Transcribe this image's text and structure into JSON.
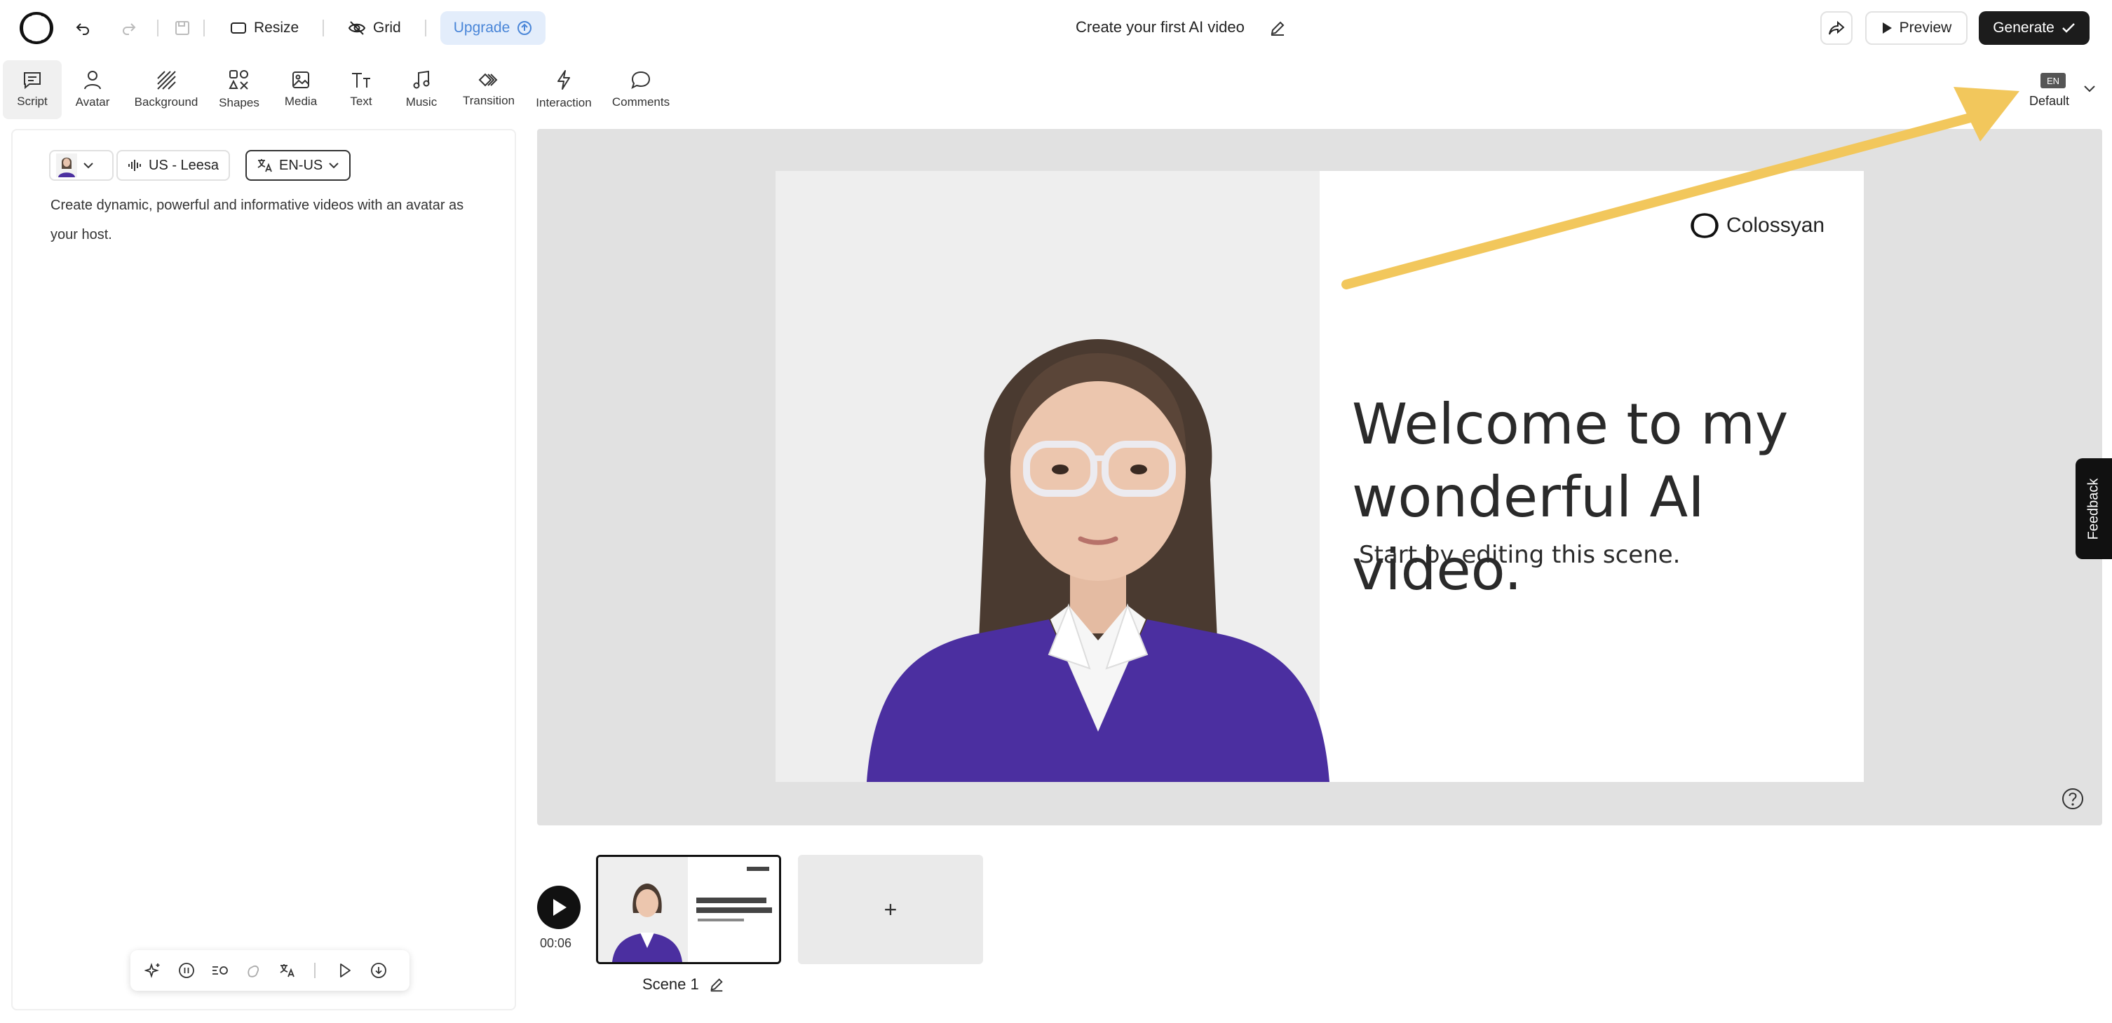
{
  "topbar": {
    "resize_label": "Resize",
    "grid_label": "Grid",
    "upgrade_label": "Upgrade",
    "title": "Create your first AI video",
    "preview_label": "Preview",
    "generate_label": "Generate"
  },
  "tools": [
    {
      "label": "Script",
      "icon": "comment-square-icon",
      "active": true
    },
    {
      "label": "Avatar",
      "icon": "person-icon"
    },
    {
      "label": "Background",
      "icon": "background-icon"
    },
    {
      "label": "Shapes",
      "icon": "shapes-icon"
    },
    {
      "label": "Media",
      "icon": "image-icon"
    },
    {
      "label": "Text",
      "icon": "text-icon"
    },
    {
      "label": "Music",
      "icon": "music-icon"
    },
    {
      "label": "Transition",
      "icon": "transition-icon"
    },
    {
      "label": "Interaction",
      "icon": "lightning-icon"
    },
    {
      "label": "Comments",
      "icon": "comment-bubble-icon"
    }
  ],
  "language": {
    "badge": "EN",
    "label": "Default"
  },
  "script": {
    "voice_label": "US - Leesa",
    "locale_label": "EN-US",
    "text": "Create dynamic, powerful and informative videos with an avatar as your host."
  },
  "slide": {
    "logo_text": "Colossyan",
    "heading": "Welcome to my wonderful AI video.",
    "subheading": "Start by editing this scene."
  },
  "timeline": {
    "time": "00:06",
    "scene_label": "Scene 1",
    "add_label": "+"
  },
  "feedback_label": "Feedback",
  "colors": {
    "accent_upgrade_bg": "#e3edfb",
    "accent_upgrade_text": "#4a86d8",
    "generate_bg": "#1c1c1c",
    "annotation_arrow": "#f2c75c",
    "sweater": "#4b2fa0"
  }
}
